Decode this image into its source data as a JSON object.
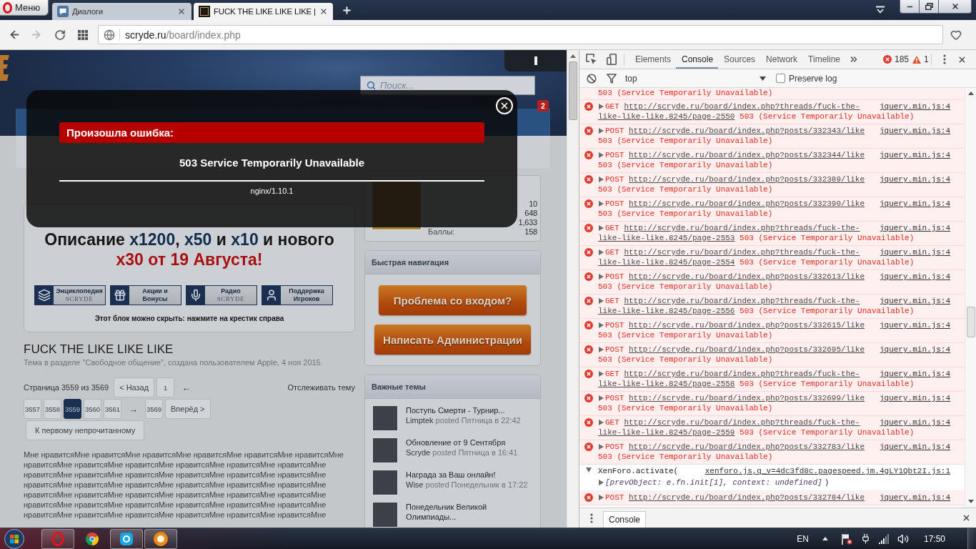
{
  "browser": {
    "menu_label": "Меню",
    "tabs": [
      {
        "title": "Диалоги",
        "kind": "chat",
        "selected": false
      },
      {
        "title": "FUCK THE LIKE LIKE LIKE |",
        "kind": "site",
        "selected": true
      }
    ],
    "forward": {
      "disabled": true
    },
    "address": {
      "host": "scryde.ru",
      "path": "/board/index.php"
    }
  },
  "page": {
    "search": {
      "placeholder": "Поиск..."
    },
    "notifications": {
      "count": "2"
    },
    "notice": {
      "headline": [
        {
          "text": "Описание ",
          "kind": "plain"
        },
        {
          "text": "x1200",
          "kind": "accent"
        },
        {
          "text": ", ",
          "kind": "plain"
        },
        {
          "text": "x50",
          "kind": "accent"
        },
        {
          "text": " и ",
          "kind": "plain"
        },
        {
          "text": "x10",
          "kind": "accent"
        },
        {
          "text": " и нового ",
          "kind": "plain"
        },
        {
          "text": "x30 от 19 Августа!",
          "kind": "alert"
        }
      ],
      "banners": [
        {
          "title": "Энциклопедия",
          "subtitle": "SCRYDE",
          "kind": "books",
          "subtitle_logo": true
        },
        {
          "title": "Акции и",
          "subtitle": "Бонусы",
          "kind": "gift",
          "subtitle_logo": false
        },
        {
          "title": "Радио",
          "subtitle": "SCRYDE",
          "kind": "microphone",
          "subtitle_logo": true
        },
        {
          "title": "Поддержка",
          "subtitle": "Игроков",
          "kind": "support",
          "subtitle_logo": false
        }
      ],
      "hint": "Этот блок можно скрыть: нажмите на крестик справа"
    },
    "thread": {
      "title": "FUCK THE LIKE LIKE LIKE",
      "meta": "Тема в разделе \"Свободное общение\", создана пользователем Apple, 4 ноя 2015.",
      "page_info": "Страница 3559 из 3569",
      "page_links": [
        {
          "label": "< Назад",
          "kind": "step",
          "selected": false
        },
        {
          "label": "1",
          "kind": "page",
          "selected": false
        },
        {
          "label": "←",
          "kind": "arrow",
          "selected": false
        },
        {
          "label": "3557",
          "kind": "page",
          "selected": false
        },
        {
          "label": "3558",
          "kind": "page",
          "selected": false
        },
        {
          "label": "3559",
          "kind": "page",
          "selected": true
        },
        {
          "label": "3560",
          "kind": "page",
          "selected": false
        },
        {
          "label": "3561",
          "kind": "page",
          "selected": false
        },
        {
          "label": "→",
          "kind": "arrow",
          "selected": false
        },
        {
          "label": "3569",
          "kind": "page",
          "selected": false
        },
        {
          "label": "Вперёд >",
          "kind": "step",
          "selected": false
        }
      ],
      "watch": "Отслеживать тему",
      "unread_button": "К первому непрочитанному",
      "post": "Мне нравитсяМне нравитсяМне нравитсяМне нравитсяМне нравитсяМне нравитсяМне нравитсяМне нравитсяМне нравитсяМне нравитсяМне нравитсяМне нравитсяМне нравитсяМне нравитсяМне нравитсяМне нравитсяМне нравитсяМне нравитсяМне нравитсяМне нравитсяМне нравитсяМне нравитсяМне нравитсяМне нравитсяМне нравитсяМне нравитсяМне нравитсяМне нравитсяМне нравитсяМне нравитсяМне нравитсяМне нравитсяМне нравитсяМне нравитсяМне нравитсяМне нравитсяМне нравитсяМне нравитсяМне нравитсяМне нравитсяМне нравитсяМне нравитсяМне"
    },
    "sidebar": {
      "profile": {
        "stats": [
          {
            "value": "10"
          },
          {
            "value": "648"
          },
          {
            "value": "1,633"
          },
          {
            "label": "Баллы:",
            "value": "158"
          }
        ]
      },
      "quick_nav": {
        "title": "Быстрая навигация",
        "buttons": [
          "Проблема со входом?",
          "Написать Администрации"
        ]
      },
      "important": {
        "title": "Важные темы",
        "topics": [
          {
            "title": "Поступь Смерти - Турнир...",
            "author": "Limptek",
            "posted": "posted Пятница в 22:42"
          },
          {
            "title": "Обновление от 9 Сентября",
            "author": "Scryde",
            "posted": "posted Пятница в 16:41"
          },
          {
            "title": "Награда за Ваш онлайн!",
            "author": "Wise",
            "posted": "posted Понедельник в 17:22"
          },
          {
            "title": "Понедельник Великой Олимпиады..."
          }
        ]
      }
    }
  },
  "error_dialog": {
    "title": "Произошла ошибка:",
    "message": "503 Service Temporarily Unavailable",
    "server": "nginx/1.10.1"
  },
  "devtools": {
    "tabs": [
      {
        "label": "Elements",
        "selected": false
      },
      {
        "label": "Console",
        "selected": true
      },
      {
        "label": "Sources",
        "selected": false
      },
      {
        "label": "Network",
        "selected": false
      },
      {
        "label": "Timeline",
        "selected": false
      }
    ],
    "counts": {
      "errors": "185",
      "warnings": "1"
    },
    "context": "top",
    "preserve_log": {
      "label": "Preserve log",
      "checked": false
    },
    "log": [
      {
        "kind": "continuation",
        "lines": [
          {
            "status": "503 (Service Temporarily Unavailable)"
          }
        ]
      },
      {
        "kind": "error",
        "expanded": false,
        "source": "jquery.min.js:4",
        "lines": [
          {
            "method": "GET",
            "url": "http://scryde.ru/board/index.php?threads/fuck-the-"
          },
          {
            "url": "like-like-like.8245/page-2550",
            "status": "503 (Service Temporarily Unavailable)"
          }
        ]
      },
      {
        "kind": "error",
        "expanded": false,
        "source": "jquery.min.js:4",
        "lines": [
          {
            "method": "POST",
            "url": "http://scryde.ru/board/index.php?posts/332343/like"
          },
          {
            "status": "503 (Service Temporarily Unavailable)"
          }
        ]
      },
      {
        "kind": "error",
        "expanded": false,
        "source": "jquery.min.js:4",
        "lines": [
          {
            "method": "POST",
            "url": "http://scryde.ru/board/index.php?posts/332344/like"
          },
          {
            "status": "503 (Service Temporarily Unavailable)"
          }
        ]
      },
      {
        "kind": "error",
        "expanded": false,
        "source": "jquery.min.js:4",
        "lines": [
          {
            "method": "POST",
            "url": "http://scryde.ru/board/index.php?posts/332389/like"
          },
          {
            "status": "503 (Service Temporarily Unavailable)"
          }
        ]
      },
      {
        "kind": "error",
        "expanded": false,
        "source": "jquery.min.js:4",
        "lines": [
          {
            "method": "POST",
            "url": "http://scryde.ru/board/index.php?posts/332390/like"
          },
          {
            "status": "503 (Service Temporarily Unavailable)"
          }
        ]
      },
      {
        "kind": "error",
        "expanded": false,
        "source": "jquery.min.js:4",
        "lines": [
          {
            "method": "GET",
            "url": "http://scryde.ru/board/index.php?threads/fuck-the-"
          },
          {
            "url": "like-like-like.8245/page-2553",
            "status": "503 (Service Temporarily Unavailable)"
          }
        ]
      },
      {
        "kind": "error",
        "expanded": false,
        "source": "jquery.min.js:4",
        "lines": [
          {
            "method": "GET",
            "url": "http://scryde.ru/board/index.php?threads/fuck-the-"
          },
          {
            "url": "like-like-like.8245/page-2554",
            "status": "503 (Service Temporarily Unavailable)"
          }
        ]
      },
      {
        "kind": "error",
        "expanded": false,
        "source": "jquery.min.js:4",
        "lines": [
          {
            "method": "POST",
            "url": "http://scryde.ru/board/index.php?posts/332613/like"
          },
          {
            "status": "503 (Service Temporarily Unavailable)"
          }
        ]
      },
      {
        "kind": "error",
        "expanded": false,
        "source": "jquery.min.js:4",
        "lines": [
          {
            "method": "GET",
            "url": "http://scryde.ru/board/index.php?threads/fuck-the-"
          },
          {
            "url": "like-like-like.8245/page-2556",
            "status": "503 (Service Temporarily Unavailable)"
          }
        ]
      },
      {
        "kind": "error",
        "expanded": false,
        "source": "jquery.min.js:4",
        "lines": [
          {
            "method": "POST",
            "url": "http://scryde.ru/board/index.php?posts/332615/like"
          },
          {
            "status": "503 (Service Temporarily Unavailable)"
          }
        ]
      },
      {
        "kind": "error",
        "expanded": false,
        "source": "jquery.min.js:4",
        "lines": [
          {
            "method": "POST",
            "url": "http://scryde.ru/board/index.php?posts/332695/like"
          },
          {
            "status": "503 (Service Temporarily Unavailable)"
          }
        ]
      },
      {
        "kind": "error",
        "expanded": false,
        "source": "jquery.min.js:4",
        "lines": [
          {
            "method": "GET",
            "url": "http://scryde.ru/board/index.php?threads/fuck-the-"
          },
          {
            "url": "like-like-like.8245/page-2558",
            "status": "503 (Service Temporarily Unavailable)"
          }
        ]
      },
      {
        "kind": "error",
        "expanded": false,
        "source": "jquery.min.js:4",
        "lines": [
          {
            "method": "POST",
            "url": "http://scryde.ru/board/index.php?posts/332699/like"
          },
          {
            "status": "503 (Service Temporarily Unavailable)"
          }
        ]
      },
      {
        "kind": "error",
        "expanded": false,
        "source": "jquery.min.js:4",
        "lines": [
          {
            "method": "GET",
            "url": "http://scryde.ru/board/index.php?threads/fuck-the-"
          },
          {
            "url": "like-like-like.8245/page-2559",
            "status": "503 (Service Temporarily Unavailable)"
          }
        ]
      },
      {
        "kind": "error",
        "expanded": false,
        "source": "jquery.min.js:4",
        "lines": [
          {
            "method": "POST",
            "url": "http://scryde.ru/board/index.php?posts/332783/like"
          },
          {
            "status": "503 (Service Temporarily Unavailable)"
          }
        ]
      },
      {
        "kind": "log",
        "expanded": true,
        "expression": "XenForo.activate(",
        "source": "xenforo.js,q_v=4dc3fd8c.pagespeed.jm.4gLY1Qbt2I.js:1",
        "argument": {
          "text": "[prevObject: e.fn.init[1], context: undefined]",
          "expanded": false
        },
        "closing": ")"
      },
      {
        "kind": "error",
        "expanded": false,
        "source": "jquery.min.js:4",
        "lines": [
          {
            "method": "POST",
            "url": "http://scryde.ru/board/index.php?posts/332784/like"
          }
        ]
      }
    ],
    "drawer_tab": "Console"
  },
  "taskbar": {
    "apps": [
      {
        "kind": "ring",
        "active": true
      },
      {
        "kind": "tricolor",
        "active": false
      },
      {
        "kind": "tile",
        "active": true
      },
      {
        "kind": "orb",
        "active": true
      }
    ],
    "language": "EN",
    "time": "17:50"
  }
}
